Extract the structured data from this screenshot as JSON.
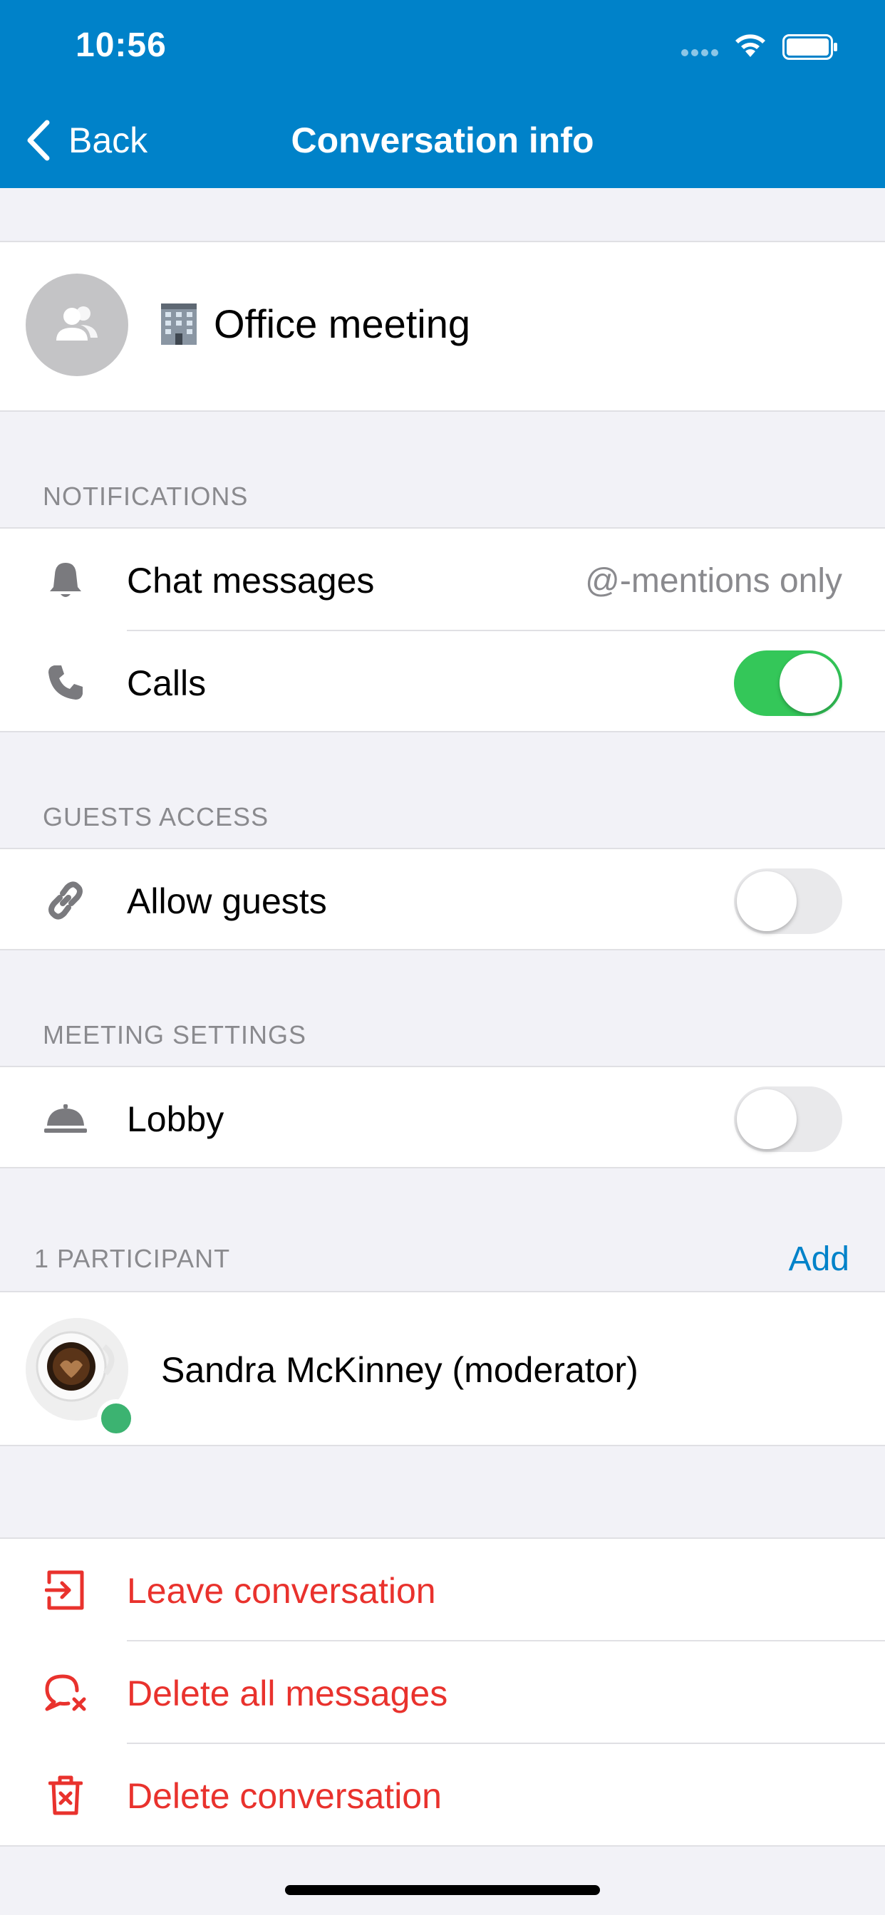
{
  "status_bar": {
    "time": "10:56"
  },
  "nav": {
    "back_label": "Back",
    "title": "Conversation info"
  },
  "conversation": {
    "name": "Office meeting",
    "emoji_icon": "office-building-icon",
    "avatar_icon": "group-icon"
  },
  "notifications": {
    "header": "NOTIFICATIONS",
    "chat_messages_label": "Chat messages",
    "chat_messages_value": "@-mentions only",
    "calls_label": "Calls",
    "calls_enabled": true
  },
  "guests": {
    "header": "GUESTS ACCESS",
    "allow_guests_label": "Allow guests",
    "allow_guests_enabled": false
  },
  "meeting": {
    "header": "MEETING SETTINGS",
    "lobby_label": "Lobby",
    "lobby_enabled": false
  },
  "participants": {
    "header": "1 PARTICIPANT",
    "add_label": "Add",
    "items": [
      {
        "name": "Sandra McKinney (moderator)",
        "status": "online"
      }
    ]
  },
  "actions": {
    "leave_label": "Leave conversation",
    "delete_messages_label": "Delete all messages",
    "delete_conversation_label": "Delete conversation"
  },
  "colors": {
    "brand": "#0082c9",
    "toggle_on": "#34c759",
    "danger": "#e9322d",
    "online": "#3cb371"
  }
}
